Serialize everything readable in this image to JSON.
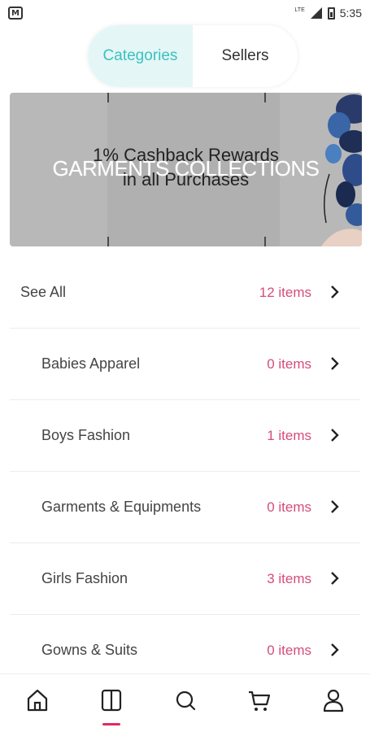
{
  "status_bar": {
    "app_icon_letter": "M",
    "network_label": "LTE",
    "time": "5:35"
  },
  "segmented_control": {
    "tabs": [
      {
        "label": "Categories",
        "active": true
      },
      {
        "label": "Sellers",
        "active": false
      }
    ],
    "active_color": "#3cc1c1",
    "active_bg": "#e4f6f6"
  },
  "banner": {
    "promo_line1": "1% Cashback Rewards",
    "promo_line2": "in all Purchases",
    "title": "GARMENTS COLLECTIONS"
  },
  "categories": [
    {
      "label": "See All",
      "count": "12 items",
      "level": "top"
    },
    {
      "label": "Babies Apparel",
      "count": "0 items",
      "level": "sub"
    },
    {
      "label": "Boys Fashion",
      "count": "1 items",
      "level": "sub"
    },
    {
      "label": "Garments & Equipments",
      "count": "0 items",
      "level": "sub"
    },
    {
      "label": "Girls Fashion",
      "count": "3 items",
      "level": "sub"
    },
    {
      "label": "Gowns & Suits",
      "count": "0 items",
      "level": "sub"
    }
  ],
  "bottom_nav": {
    "items": [
      {
        "icon": "home-icon",
        "active": false
      },
      {
        "icon": "categories-icon",
        "active": true
      },
      {
        "icon": "search-icon",
        "active": false
      },
      {
        "icon": "cart-icon",
        "active": false
      },
      {
        "icon": "profile-icon",
        "active": false
      }
    ],
    "active_color": "#e2295f"
  },
  "colors": {
    "count_text": "#d64c7a",
    "accent": "#3cc1c1"
  }
}
